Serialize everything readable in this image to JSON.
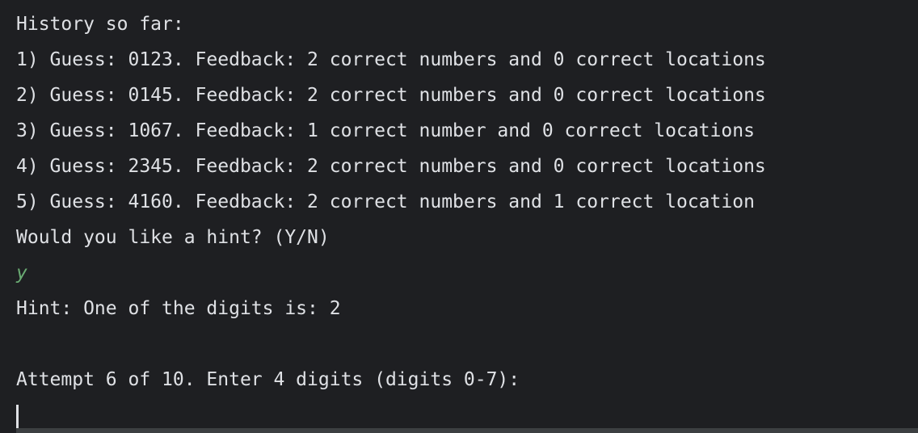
{
  "console": {
    "lines": [
      "History so far:",
      "1) Guess: 0123. Feedback: 2 correct numbers and 0 correct locations",
      "2) Guess: 0145. Feedback: 2 correct numbers and 0 correct locations",
      "3) Guess: 1067. Feedback: 1 correct number and 0 correct locations",
      "4) Guess: 2345. Feedback: 2 correct numbers and 0 correct locations",
      "5) Guess: 4160. Feedback: 2 correct numbers and 1 correct location",
      "Would you like a hint? (Y/N)",
      "y",
      "Hint: One of the digits is: 2",
      "",
      "Attempt 6 of 10. Enter 4 digits (digits 0-7):"
    ]
  },
  "colors": {
    "background": "#1e1f22",
    "text": "#dfe1e5",
    "user_input": "#6aab73"
  }
}
